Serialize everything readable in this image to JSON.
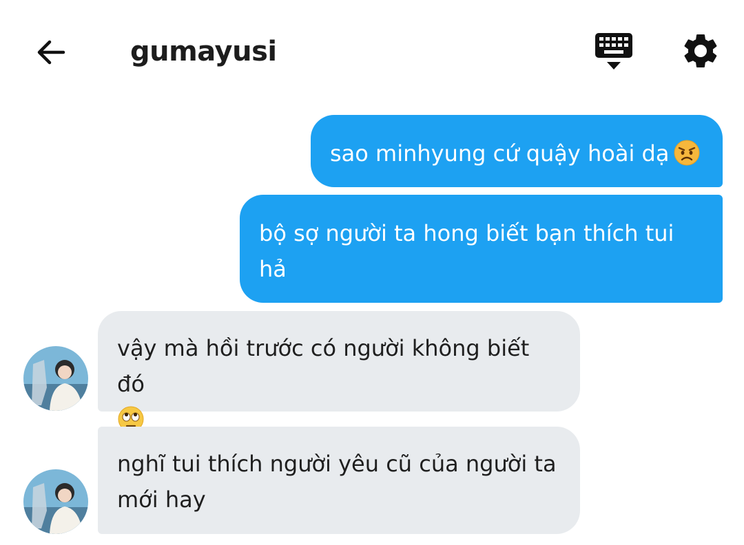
{
  "header": {
    "title": "gumayusi",
    "back_icon": "arrow-left-icon",
    "keyboard_icon": "keyboard-icon",
    "settings_icon": "gear-icon"
  },
  "colors": {
    "outgoing_bubble": "#1da1f2",
    "incoming_bubble": "#e8ebee",
    "text_dark": "#1f1f1f"
  },
  "messages": [
    {
      "direction": "outgoing",
      "text": "sao minhyung cứ quậy hoài dạ",
      "emoji": "angry-face-emoji"
    },
    {
      "direction": "outgoing",
      "text": "bộ sợ người ta hong biết bạn thích tui hả"
    },
    {
      "direction": "incoming",
      "text": "vậy mà hồi trước có người không biết đó",
      "emoji": "eye-roll-emoji"
    },
    {
      "direction": "incoming",
      "text": "nghĩ tui thích người yêu cũ của người ta mới hay"
    }
  ]
}
